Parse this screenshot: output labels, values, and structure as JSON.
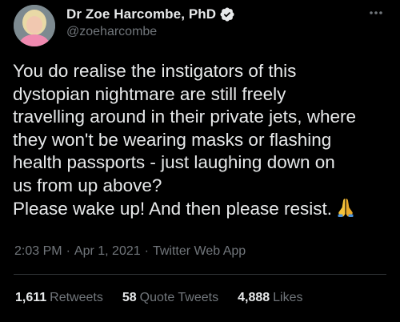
{
  "author": {
    "display_name": "Dr Zoe Harcombe, PhD",
    "handle": "@zoeharcombe",
    "avatar_icon": "avatar-photo",
    "verified": true
  },
  "tweet": {
    "lines": [
      "You do realise the instigators of this",
      "dystopian nightmare are still freely",
      "travelling around in their private jets, where",
      "they won't be wearing masks or flashing",
      "health passports - just laughing down on",
      "us from up above?",
      "Please wake up! And then please resist."
    ],
    "emoji_icon": "folded-hands-icon"
  },
  "meta": {
    "time": "2:03 PM",
    "sep1": "·",
    "date": "Apr 1, 2021",
    "sep2": "·",
    "source": "Twitter Web App"
  },
  "stats": {
    "retweets_count": "1,611",
    "retweets_label": "Retweets",
    "quotes_count": "58",
    "quotes_label": "Quote Tweets",
    "likes_count": "4,888",
    "likes_label": "Likes"
  },
  "colors": {
    "background": "#000000",
    "text": "#e7e9ea",
    "secondary_text": "#71767b",
    "verified_blue": "#1d9bf0",
    "divider": "#2f3336"
  }
}
